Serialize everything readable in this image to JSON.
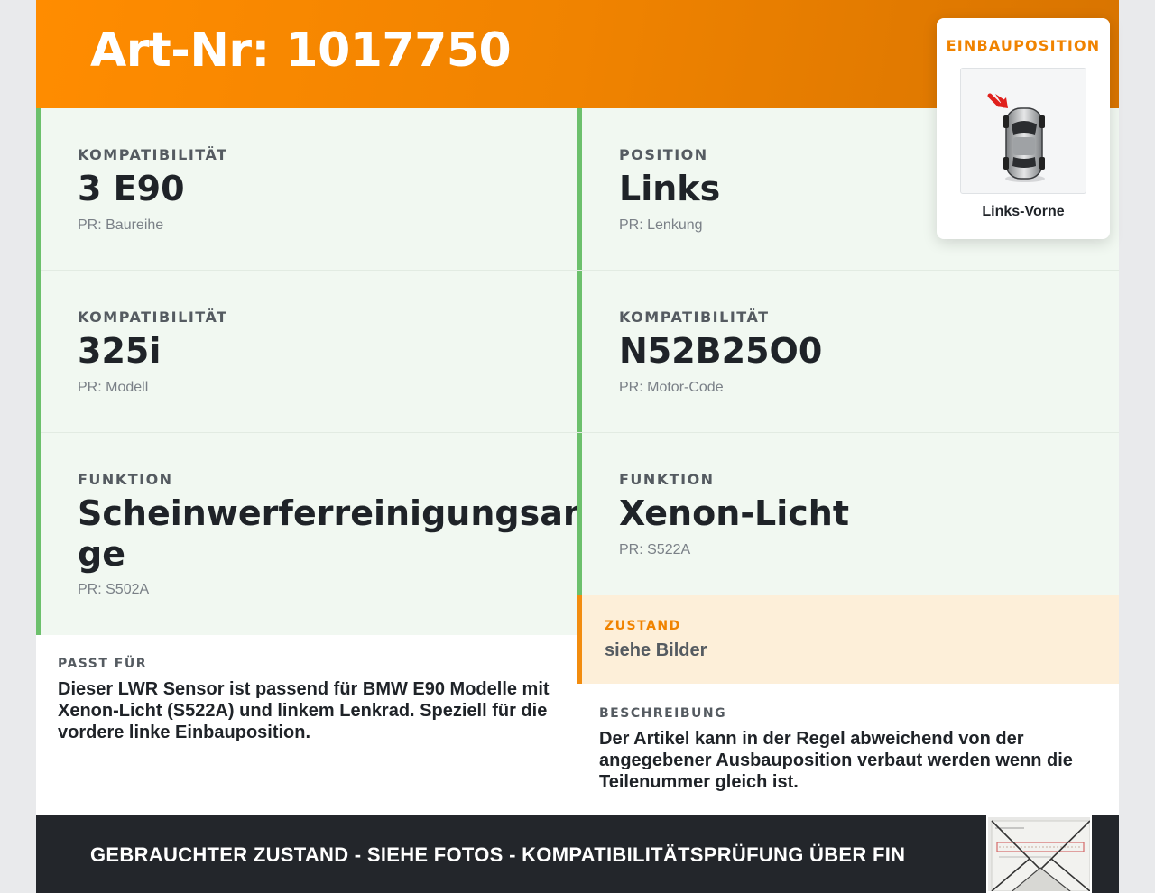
{
  "header": {
    "title": "Art-Nr: 1017750"
  },
  "cells": [
    {
      "label": "KOMPATIBILITÄT",
      "value": "3 E90",
      "sub": "PR: Baureihe"
    },
    {
      "label": "POSITION",
      "value": "Links",
      "sub": "PR: Lenkung"
    },
    {
      "label": "KOMPATIBILITÄT",
      "value": "325i",
      "sub": "PR: Modell"
    },
    {
      "label": "KOMPATIBILITÄT",
      "value": "N52B25O0",
      "sub": "PR: Motor-Code"
    },
    {
      "label": "FUNKTION",
      "value": "Scheinwerferreinigungsanlage",
      "value_line1": "Scheinwerferreinigungsanla",
      "value_line2": "ge",
      "sub": "PR: S502A"
    },
    {
      "label": "FUNKTION",
      "value": "Xenon-Licht",
      "sub": "PR: S522A"
    }
  ],
  "zustand": {
    "label": "ZUSTAND",
    "value": "siehe Bilder"
  },
  "passt_fuer": {
    "label": "PASST FÜR",
    "text": "Dieser LWR Sensor ist passend für BMW E90 Modelle mit Xenon-Licht (S522A) und linkem Lenkrad. Speziell für die vordere linke Einbauposition."
  },
  "beschreibung": {
    "label": "BESCHREIBUNG",
    "text": "Der Artikel kann in der Regel abweichend von der angegebener Ausbauposition verbaut werden wenn die Teilenummer gleich ist."
  },
  "footer": {
    "text": "GEBRAUCHTER ZUSTAND - SIEHE FOTOS - KOMPATIBILITÄTSPRÜFUNG ÜBER FIN"
  },
  "einbauposition": {
    "label": "EINBAUPOSITION",
    "caption": "Links-Vorne",
    "image_icon": "car-topview-icon",
    "arrow_color": "#e0201c"
  },
  "colors": {
    "accent": "#f08300",
    "ok_border": "#6cc06c",
    "ok_bg": "#f1f8f1",
    "warn_bg": "#fdefd9",
    "footer_bg": "#23262b"
  }
}
